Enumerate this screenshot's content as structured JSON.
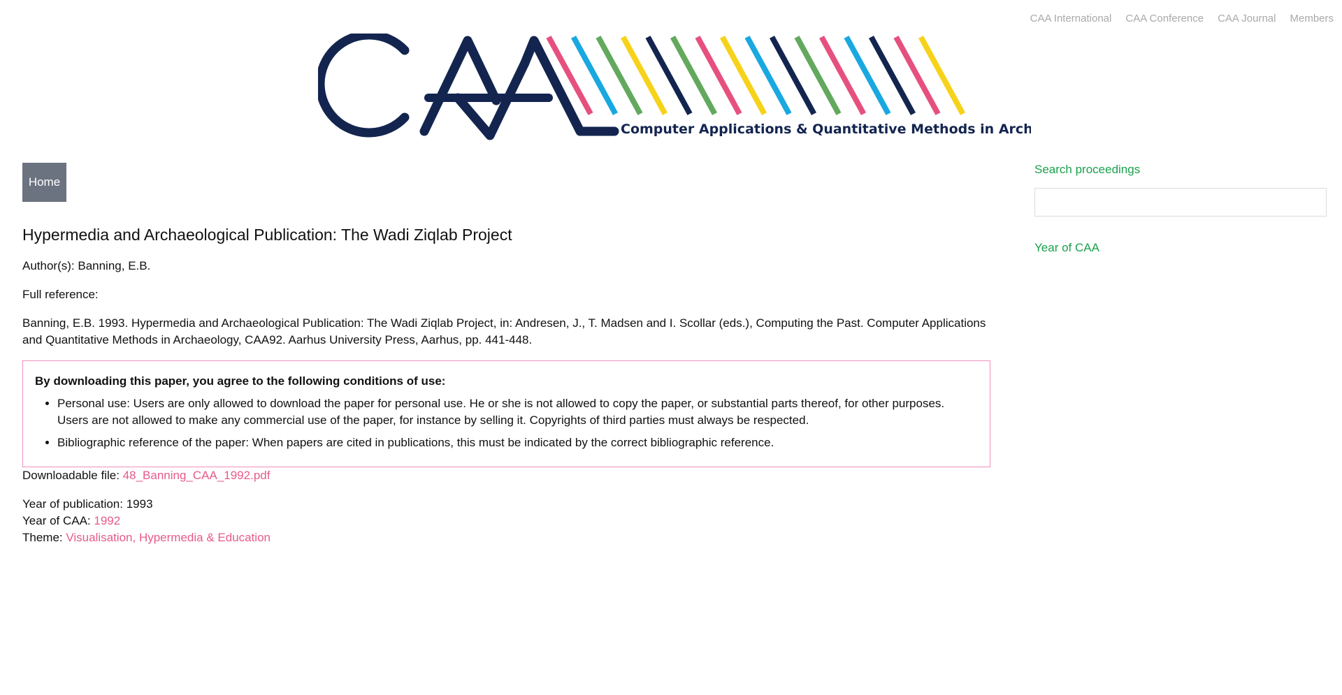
{
  "top_nav": [
    "CAA International",
    "CAA Conference",
    "CAA Journal",
    "Members"
  ],
  "logo": {
    "tagline": "Computer Applications & Quantitative Methods in Archaeology",
    "colors": {
      "navy": "#13254f",
      "stripes": [
        "#e6507f",
        "#19a8e0",
        "#62a95e",
        "#f7d21b",
        "#13254f"
      ]
    }
  },
  "home_button": "Home",
  "article": {
    "title": "Hypermedia and Archaeological Publication: The Wadi Ziqlab Project",
    "authors": "Author(s): Banning, E.B.",
    "full_reference_label": "Full reference:",
    "reference": "Banning, E.B. 1993. Hypermedia and Archaeological Publication: The Wadi Ziqlab Project, in: Andresen, J., T. Madsen and I. Scollar (eds.), Computing the Past. Computer Applications and Quantitative Methods in Archaeology, CAA92. Aarhus University Press, Aarhus, pp. 441-448.",
    "terms": {
      "heading": "By downloading this paper, you agree to the following conditions of use:",
      "items": [
        "Personal use: Users are only allowed to download the paper for personal use. He or she is not allowed to copy the paper, or substantial parts thereof, for other purposes. Users are not allowed to make any commercial use of the paper, for instance by selling it. Copyrights of third parties must always be respected.",
        "Bibliographic reference of the paper: When papers are cited in publications, this must be indicated by the correct bibliographic reference."
      ]
    },
    "download_label": "Downloadable file: ",
    "download_file": "48_Banning_CAA_1992.pdf",
    "year_pub_label": "Year of publication: ",
    "year_pub": "1993",
    "year_caa_label": "Year of CAA: ",
    "year_caa": "1992",
    "theme_label": "Theme: ",
    "theme": "Visualisation, Hypermedia & Education"
  },
  "sidebar": {
    "search_label": "Search proceedings",
    "search_value": "",
    "year_label": "Year of CAA"
  }
}
